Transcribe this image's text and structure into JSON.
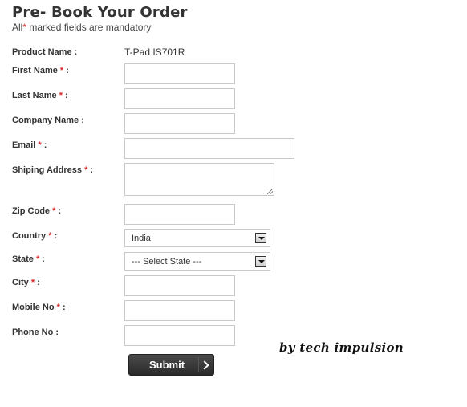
{
  "header": {
    "title": "Pre- Book Your Order",
    "subtitle_prefix": "All",
    "required_mark": "*",
    "subtitle_suffix": " marked fields are mandatory"
  },
  "form": {
    "product": {
      "label": "Product Name :",
      "value": "T-Pad IS701R"
    },
    "first_name": {
      "label": "First Name",
      "required": "*",
      "colon": " :",
      "value": ""
    },
    "last_name": {
      "label": "Last Name",
      "required": "*",
      "colon": " :",
      "value": ""
    },
    "company_name": {
      "label": "Company Name :",
      "value": ""
    },
    "email": {
      "label": "Email",
      "required": "*",
      "colon": " :",
      "value": ""
    },
    "shipping_address": {
      "label": "Shiping Address",
      "required": "*",
      "colon": " :",
      "value": ""
    },
    "zip_code": {
      "label": "Zip Code",
      "required": "*",
      "colon": " :",
      "value": ""
    },
    "country": {
      "label": "Country",
      "required": "*",
      "colon": " :",
      "selected": "India"
    },
    "state": {
      "label": "State",
      "required": "*",
      "colon": " :",
      "selected": "--- Select State ---"
    },
    "city": {
      "label": "City",
      "required": "*",
      "colon": " :",
      "value": ""
    },
    "mobile_no": {
      "label": "Mobile No",
      "required": "*",
      "colon": " :",
      "value": ""
    },
    "phone_no": {
      "label": "Phone No :",
      "value": ""
    },
    "submit_label": "Submit"
  },
  "credit": "by tech impulsion",
  "colors": {
    "required": "#d62b2b",
    "button": "#333333",
    "border": "#c9c9c9"
  }
}
